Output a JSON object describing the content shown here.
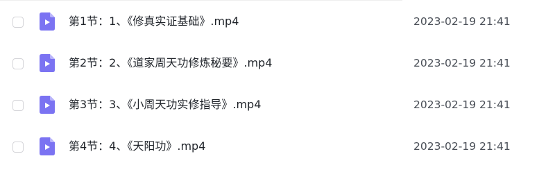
{
  "file_list": {
    "accent_color": "#7b73f2",
    "file_icon": "video-file-icon",
    "rows": [
      {
        "name": "第1节：1、《修真实证基础》.mp4",
        "date": "2023-02-19 21:41",
        "checked": false
      },
      {
        "name": "第2节：2、《道家周天功修炼秘要》.mp4",
        "date": "2023-02-19 21:41",
        "checked": false
      },
      {
        "name": "第3节：3、《小周天功实修指导》.mp4",
        "date": "2023-02-19 21:41",
        "checked": false
      },
      {
        "name": "第4节：4、《天阳功》.mp4",
        "date": "2023-02-19 21:41",
        "checked": false
      }
    ]
  }
}
